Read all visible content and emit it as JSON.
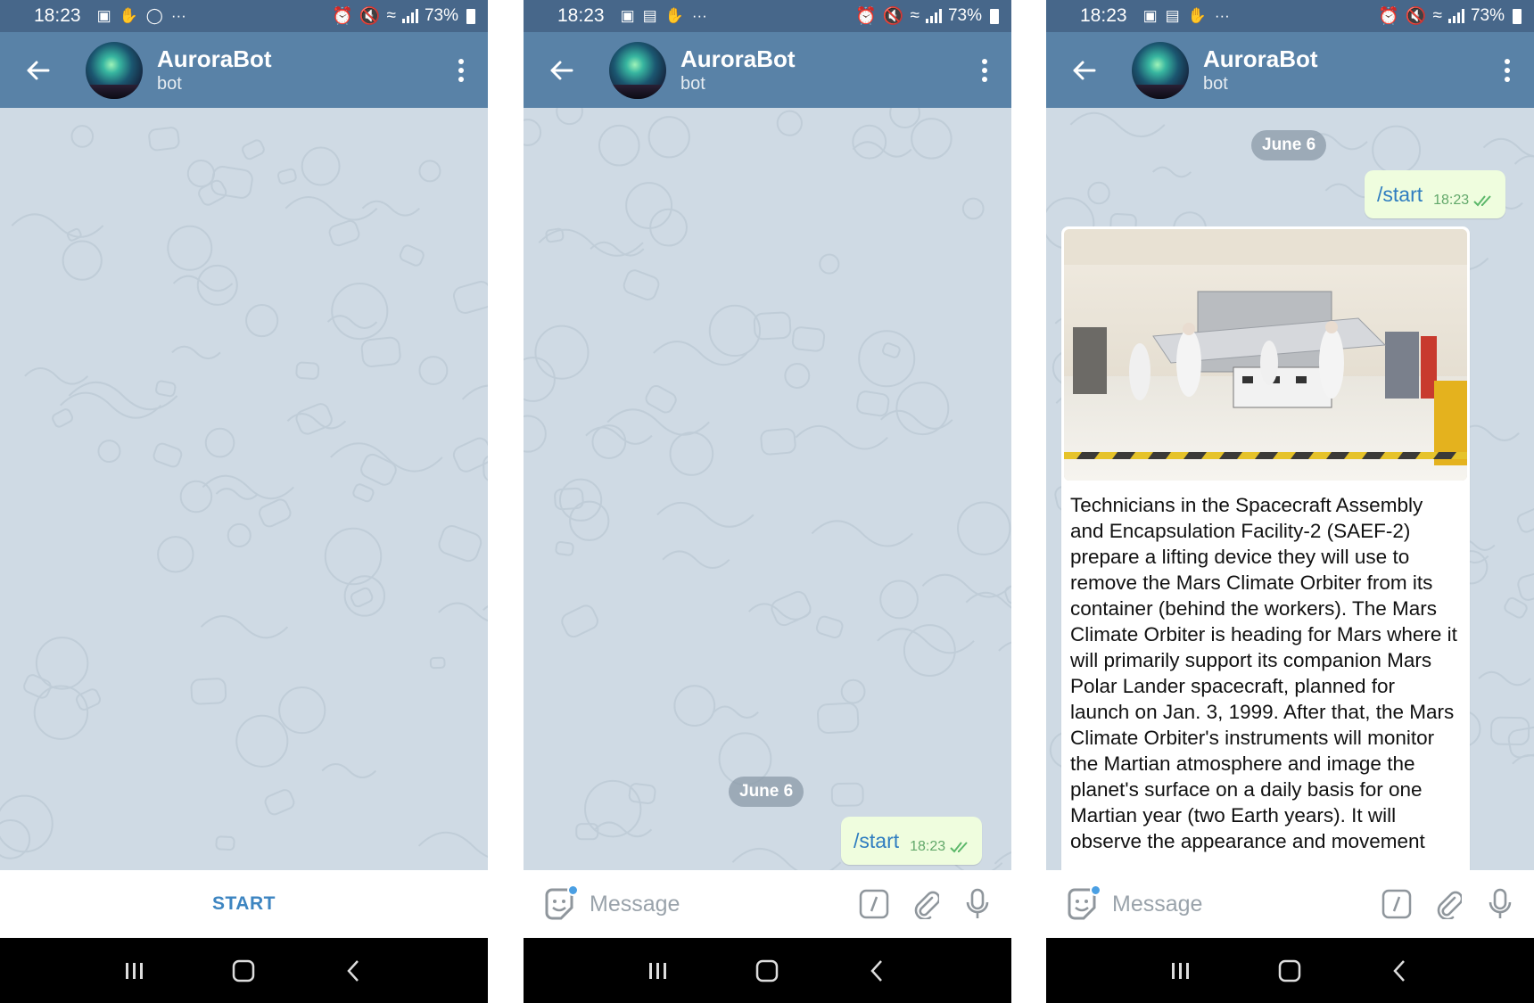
{
  "status_bar": {
    "time": "18:23",
    "battery": "73%",
    "panel1_icons": [
      "bus-icon",
      "hand-icon",
      "instagram-icon",
      "more-icon"
    ],
    "panel23_icons": [
      "bus-icon",
      "image-icon",
      "hand-icon",
      "more-icon"
    ]
  },
  "chat": {
    "title": "AuroraBot",
    "subtitle": "bot"
  },
  "panels": [
    {
      "state": "empty",
      "bottom": {
        "start_label": "START"
      }
    },
    {
      "state": "sent",
      "date_label": "June 6",
      "outgoing": {
        "text": "/start",
        "time": "18:23"
      },
      "composer": {
        "placeholder": "Message"
      }
    },
    {
      "state": "reply",
      "date_label": "June 6",
      "outgoing": {
        "text": "/start",
        "time": "18:23"
      },
      "incoming": {
        "caption": "Technicians in the Spacecraft Assembly and Encapsulation Facility-2 (SAEF-2) prepare a lifting device they will use to remove the Mars Climate Orbiter from its container (behind the workers). The Mars Climate Orbiter is heading for Mars where it will primarily support its companion Mars Polar Lander spacecraft, planned for launch on Jan. 3, 1999. After that, the Mars Climate Orbiter's instruments will monitor the Martian atmosphere and image the planet's surface on a daily basis for one Martian year (two Earth years). It will observe the appearance and movement"
      },
      "composer": {
        "placeholder": "Message"
      }
    }
  ],
  "colors": {
    "header": "#5982a7",
    "status_bar": "#47678a",
    "chat_background": "#cfdae4",
    "outgoing_bubble": "#effdde",
    "command_link": "#2f7dc0",
    "accent": "#3d85c1"
  }
}
